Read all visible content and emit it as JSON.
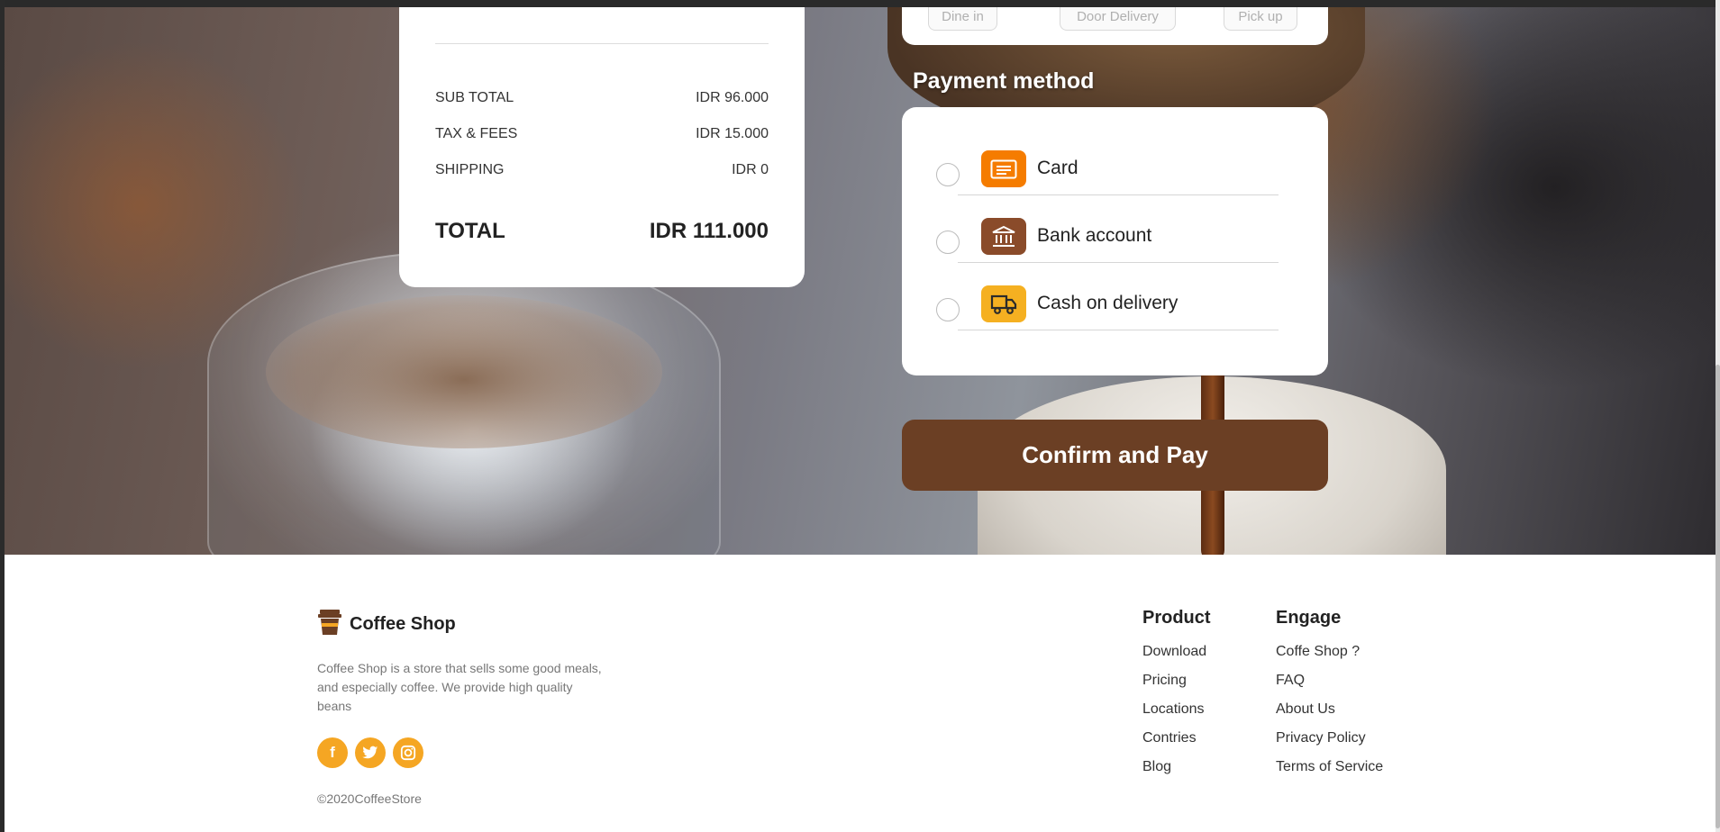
{
  "order_summary": {
    "rows": [
      {
        "label": "SUB TOTAL",
        "value": "IDR 96.000"
      },
      {
        "label": "TAX & FEES",
        "value": "IDR 15.000"
      },
      {
        "label": "SHIPPING",
        "value": "IDR 0"
      }
    ],
    "total_label": "TOTAL",
    "total_value": "IDR 111.000"
  },
  "delivery": {
    "options": [
      "Dine in",
      "Door Delivery",
      "Pick up"
    ]
  },
  "payment": {
    "title": "Payment method",
    "methods": [
      {
        "label": "Card",
        "icon": "card-icon",
        "color": "#f57c00"
      },
      {
        "label": "Bank account",
        "icon": "bank-icon",
        "color": "#8a4b2a"
      },
      {
        "label": "Cash on delivery",
        "icon": "truck-icon",
        "color": "#f5b021"
      }
    ],
    "confirm_label": "Confirm and Pay"
  },
  "footer": {
    "brand": "Coffee Shop",
    "about": "Coffee Shop is a store that sells some good meals, and especially coffee. We provide high quality beans",
    "socials": [
      {
        "icon": "facebook-icon",
        "glyph": "f"
      },
      {
        "icon": "twitter-icon",
        "glyph": "t"
      },
      {
        "icon": "instagram-icon",
        "glyph": "◎"
      }
    ],
    "copyright": "©2020CoffeeStore",
    "product": {
      "title": "Product",
      "links": [
        "Download",
        "Pricing",
        "Locations",
        "Contries",
        "Blog"
      ]
    },
    "engage": {
      "title": "Engage",
      "links": [
        "Coffe Shop ?",
        "FAQ",
        "About Us",
        "Privacy Policy",
        "Terms of Service"
      ]
    }
  },
  "colors": {
    "brand_brown": "#6b3f24",
    "accent_orange": "#f5a623"
  }
}
